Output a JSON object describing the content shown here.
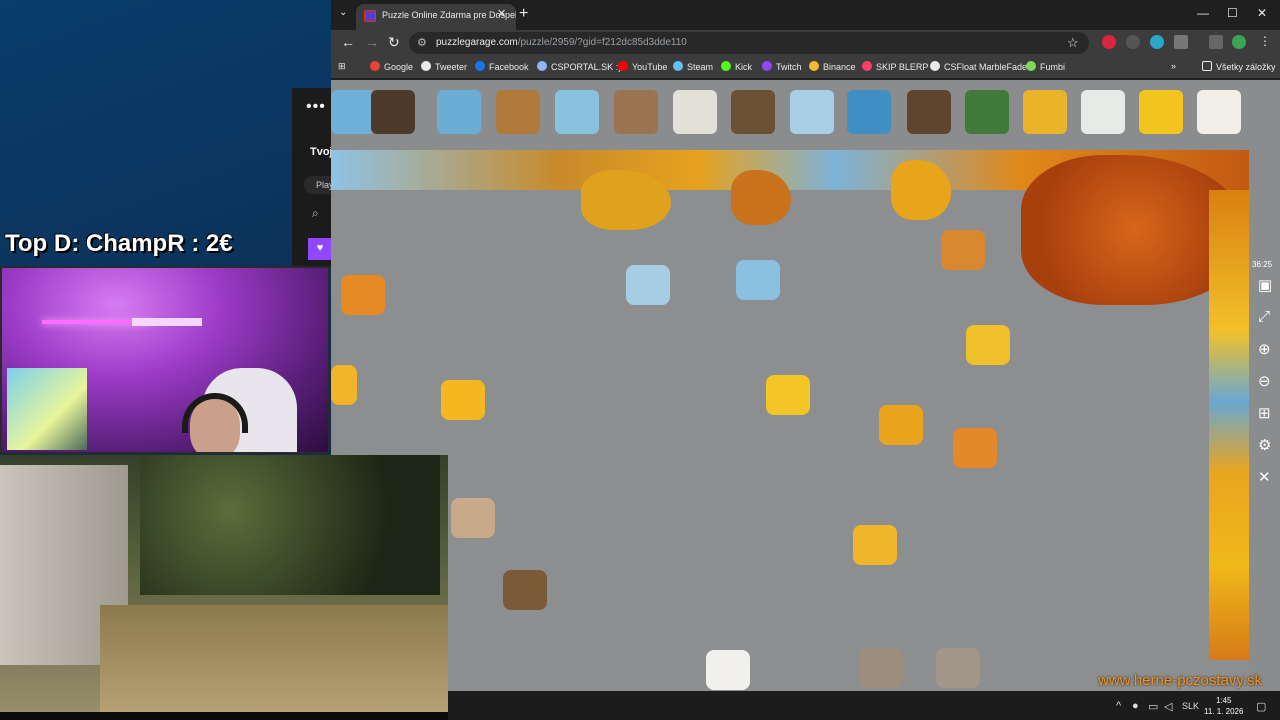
{
  "browser": {
    "tab_title": "Puzzle Online Zdarma pre Dospelých",
    "url_host": "puzzlegarage.com",
    "url_path": "/puzzle/2959/?gid=f212dc85d3dde110",
    "bookmarks": [
      {
        "label": "Google",
        "icon": "google-icon",
        "color": "#ea4335"
      },
      {
        "label": "Tweeter",
        "icon": "x-icon",
        "color": "#e8eaed"
      },
      {
        "label": "Facebook",
        "icon": "facebook-icon",
        "color": "#1877f2"
      },
      {
        "label": "CSPORTAL.SK :)",
        "icon": "csportal-icon",
        "color": "#8fb3ff"
      },
      {
        "label": "YouTube",
        "icon": "youtube-icon",
        "color": "#ff0000"
      },
      {
        "label": "Steam",
        "icon": "steam-icon",
        "color": "#66c0f4"
      },
      {
        "label": "Kick",
        "icon": "kick-icon",
        "color": "#53fc18"
      },
      {
        "label": "Twitch",
        "icon": "twitch-icon",
        "color": "#9146ff"
      },
      {
        "label": "Binance",
        "icon": "binance-icon",
        "color": "#f3ba2f"
      },
      {
        "label": "SKIP BLERP",
        "icon": "blerp-icon",
        "color": "#ff3d6b"
      },
      {
        "label": "CSFloat MarbleFade",
        "icon": "csfloat-icon",
        "color": "#e8eaed"
      },
      {
        "label": "Fumbi",
        "icon": "fumbi-icon",
        "color": "#7ed957"
      }
    ],
    "all_bookmarks": "Všetky záložky"
  },
  "puzzle": {
    "timer": "36:25"
  },
  "desktop": {
    "panel_label": "Tvoj",
    "play_label": "Play"
  },
  "stream": {
    "donation_text": "Top D: ChampR : 2€",
    "watermark": "www.herne-pczostavy.sk"
  },
  "taskbar": {
    "language": "SLK",
    "time": "1:45",
    "date": "11. 1. 2026"
  }
}
